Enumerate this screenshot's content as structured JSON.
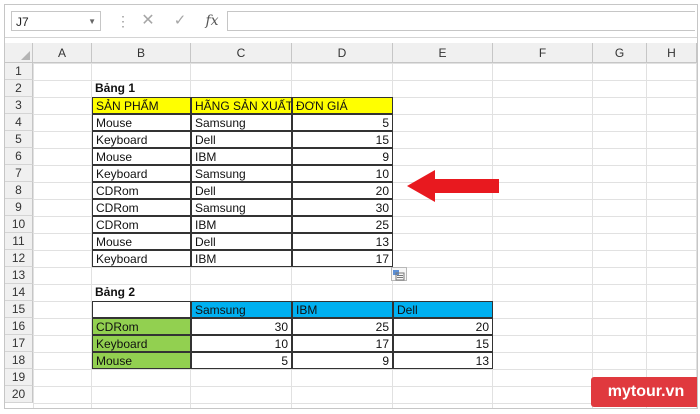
{
  "namebox": {
    "value": "J7"
  },
  "formula_bar": {
    "fx_label": "fx",
    "value": ""
  },
  "columns": [
    {
      "id": "A",
      "label": "A"
    },
    {
      "id": "B",
      "label": "B"
    },
    {
      "id": "C",
      "label": "C"
    },
    {
      "id": "D",
      "label": "D"
    },
    {
      "id": "E",
      "label": "E"
    },
    {
      "id": "F",
      "label": "F"
    },
    {
      "id": "G",
      "label": "G"
    },
    {
      "id": "H",
      "label": "H"
    }
  ],
  "rows": [
    "1",
    "2",
    "3",
    "4",
    "5",
    "6",
    "7",
    "8",
    "9",
    "10",
    "11",
    "12",
    "13",
    "14",
    "15",
    "16",
    "17",
    "18",
    "19",
    "20"
  ],
  "table1": {
    "title": "Bảng 1",
    "headers": [
      "SẢN PHẨM",
      "HÃNG SẢN XUẤT",
      "ĐƠN GIÁ"
    ],
    "rows": [
      [
        "Mouse",
        "Samsung",
        "5"
      ],
      [
        "Keyboard",
        "Dell",
        "15"
      ],
      [
        "Mouse",
        "IBM",
        "9"
      ],
      [
        "Keyboard",
        "Samsung",
        "10"
      ],
      [
        "CDRom",
        "Dell",
        "20"
      ],
      [
        "CDRom",
        "Samsung",
        "30"
      ],
      [
        "CDRom",
        "IBM",
        "25"
      ],
      [
        "Mouse",
        "Dell",
        "13"
      ],
      [
        "Keyboard",
        "IBM",
        "17"
      ]
    ]
  },
  "table2": {
    "title": "Bảng 2",
    "col_headers": [
      "Samsung",
      "IBM",
      "Dell"
    ],
    "rows": [
      {
        "label": "CDRom",
        "values": [
          "30",
          "25",
          "20"
        ]
      },
      {
        "label": "Keyboard",
        "values": [
          "10",
          "17",
          "15"
        ]
      },
      {
        "label": "Mouse",
        "values": [
          "5",
          "9",
          "13"
        ]
      }
    ]
  },
  "colors": {
    "header_yellow": "#ffff00",
    "header_blue": "#00b0f0",
    "label_green": "#92d050",
    "arrow_red": "#e8191f",
    "logo_red": "#e0393e"
  },
  "icons": {
    "cancel": "close-icon",
    "enter": "check-icon",
    "arrow": "arrow-left-icon",
    "paste": "paste-options-icon"
  },
  "logo": {
    "text": "mytour.vn"
  }
}
